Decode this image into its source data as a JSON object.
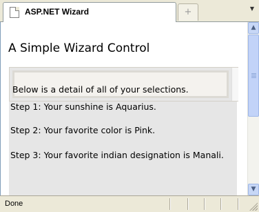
{
  "tabs": {
    "active_title": "ASP.NET Wizard",
    "new_tab_symbol": "+",
    "menu_symbol": "▼"
  },
  "page": {
    "title": "A Simple Wizard Control",
    "summary": "Below is a detail of all of your selections.",
    "steps": [
      "Step 1: Your sunshine is Aquarius.",
      "Step 2: Your favorite color is Pink.",
      "Step 3: Your favorite indian designation is Manali."
    ]
  },
  "scrollbar": {
    "up_symbol": "▲",
    "down_symbol": "▼"
  },
  "status": {
    "text": "Done"
  }
}
